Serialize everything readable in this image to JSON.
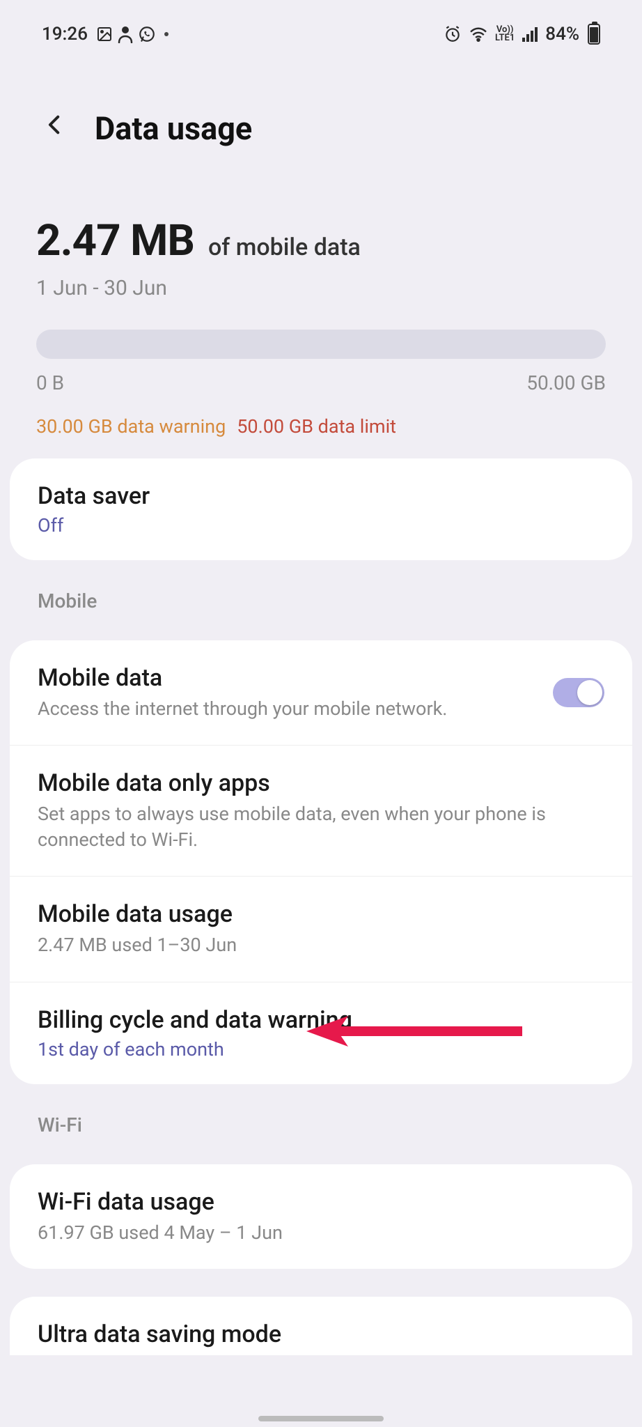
{
  "status_bar": {
    "time": "19:26",
    "battery_text": "84%"
  },
  "header": {
    "title": "Data usage"
  },
  "usage": {
    "amount": "2.47 MB",
    "of_label": "of mobile data",
    "date_range": "1 Jun - 30 Jun",
    "min_label": "0 B",
    "max_label": "50.00 GB",
    "warning_text": "30.00 GB data warning",
    "limit_text": "50.00 GB data limit"
  },
  "data_saver": {
    "title": "Data saver",
    "status": "Off"
  },
  "sections": {
    "mobile_label": "Mobile",
    "wifi_label": "Wi-Fi"
  },
  "mobile_data": {
    "title": "Mobile data",
    "sub": "Access the internet through your mobile network.",
    "enabled": true
  },
  "mobile_only_apps": {
    "title": "Mobile data only apps",
    "sub": "Set apps to always use mobile data, even when your phone is connected to Wi-Fi."
  },
  "mobile_usage": {
    "title": "Mobile data usage",
    "sub": "2.47 MB used 1–30 Jun"
  },
  "billing": {
    "title": "Billing cycle and data warning",
    "sub": "1st day of each month"
  },
  "wifi_usage": {
    "title": "Wi-Fi data usage",
    "sub": "61.97 GB used 4 May – 1 Jun"
  },
  "ultra": {
    "title": "Ultra data saving mode"
  }
}
